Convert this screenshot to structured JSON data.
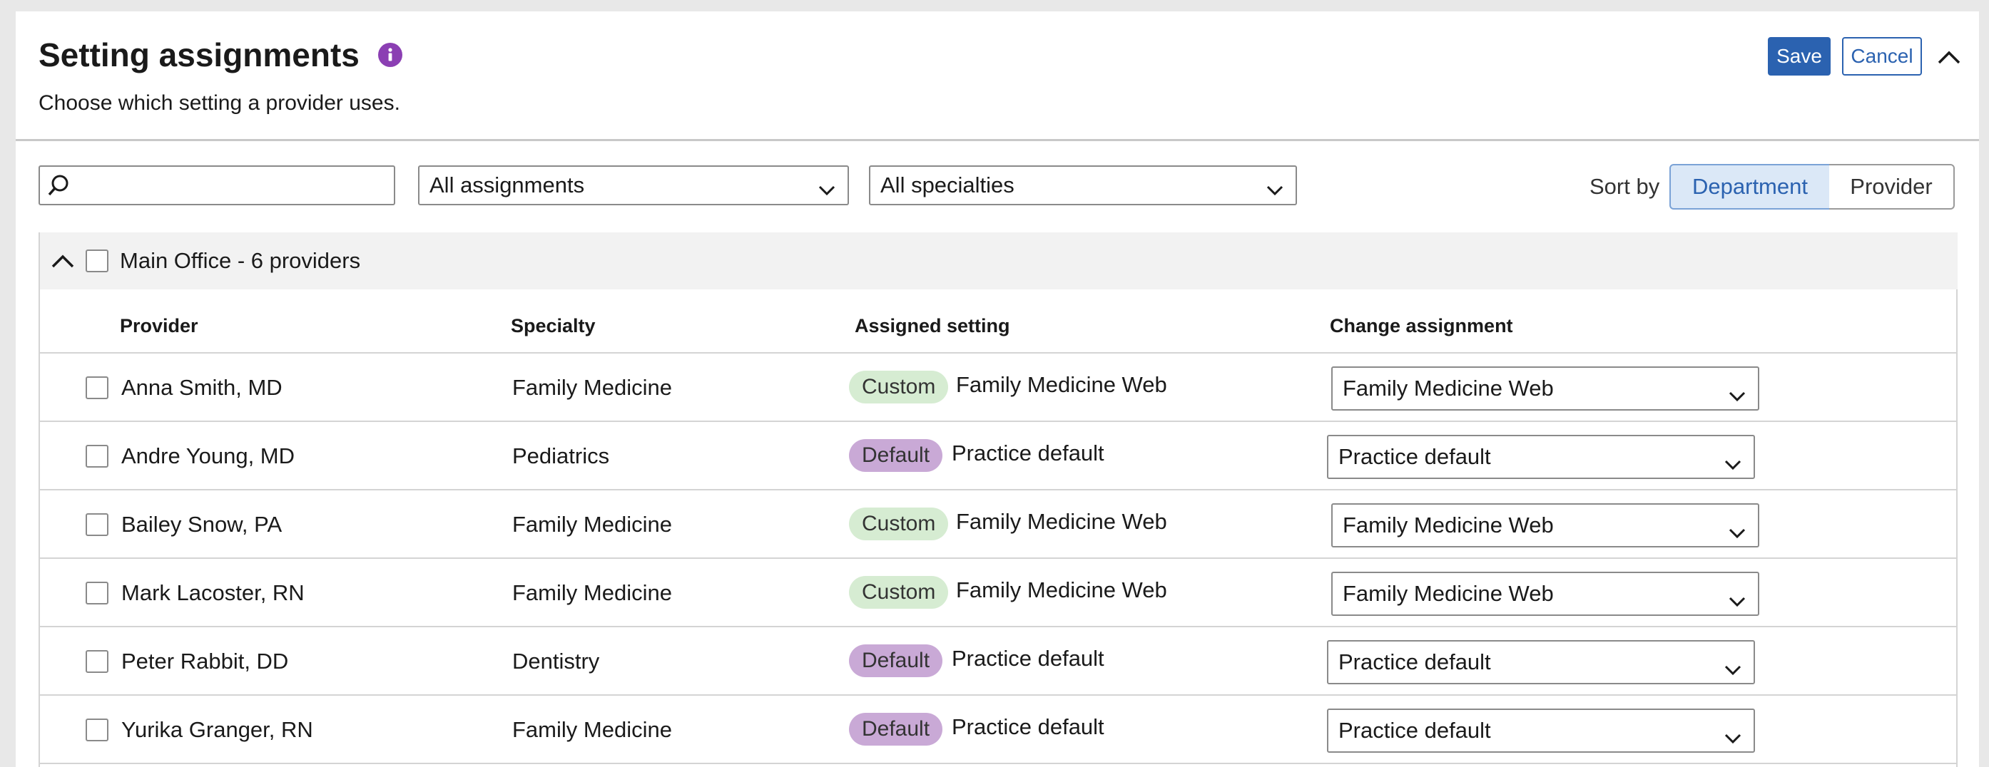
{
  "header": {
    "title": "Setting assignments",
    "subtitle": "Choose which setting a provider uses.",
    "save_label": "Save",
    "cancel_label": "Cancel"
  },
  "filters": {
    "search_placeholder": "",
    "assignments_value": "All assignments",
    "specialties_value": "All specialties",
    "sort_label": "Sort by",
    "sort_options": [
      "Department",
      "Provider"
    ],
    "sort_active": "Department"
  },
  "group": {
    "label": "Main Office - 6 providers"
  },
  "columns": {
    "provider": "Provider",
    "specialty": "Specialty",
    "assigned": "Assigned setting",
    "change": "Change assignment"
  },
  "rows": [
    {
      "provider": "Anna Smith, MD",
      "specialty": "Family Medicine",
      "badge": "Custom",
      "setting": "Family Medicine Web",
      "change": "Family Medicine Web"
    },
    {
      "provider": "Andre Young, MD",
      "specialty": "Pediatrics",
      "badge": "Default",
      "setting": "Practice default",
      "change": "Practice default"
    },
    {
      "provider": "Bailey Snow, PA",
      "specialty": "Family Medicine",
      "badge": "Custom",
      "setting": "Family Medicine Web",
      "change": "Family Medicine Web"
    },
    {
      "provider": "Mark Lacoster, RN",
      "specialty": "Family Medicine",
      "badge": "Custom",
      "setting": "Family Medicine Web",
      "change": "Family Medicine Web"
    },
    {
      "provider": "Peter Rabbit, DD",
      "specialty": "Dentistry",
      "badge": "Default",
      "setting": "Practice default",
      "change": "Practice default"
    },
    {
      "provider": "Yurika Granger, RN",
      "specialty": "Family Medicine",
      "badge": "Default",
      "setting": "Practice default",
      "change": "Practice default"
    }
  ],
  "colors": {
    "primary": "#2b62b0",
    "info": "#8b3fb3",
    "custom_badge": "#d6ecd2",
    "default_badge": "#c9a9d6"
  }
}
